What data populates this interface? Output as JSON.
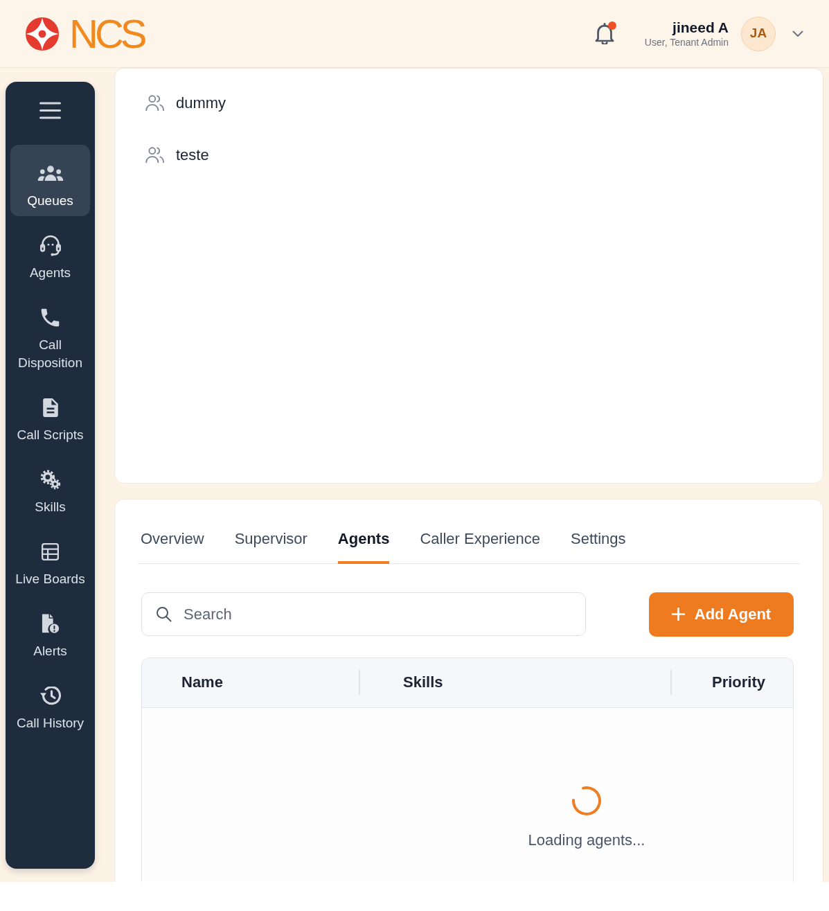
{
  "header": {
    "logo_text": "NCS",
    "notifications": {
      "unread": true
    },
    "user": {
      "name": "jineed A",
      "role": "User, Tenant Admin",
      "initials": "JA"
    }
  },
  "sidebar": {
    "items": [
      {
        "label": "Queues",
        "selected": true
      },
      {
        "label": "Agents",
        "selected": false
      },
      {
        "label": "Call Disposition",
        "selected": false
      },
      {
        "label": "Call Scripts",
        "selected": false
      },
      {
        "label": "Skills",
        "selected": false
      },
      {
        "label": "Live Boards",
        "selected": false
      },
      {
        "label": "Alerts",
        "selected": false
      },
      {
        "label": "Call History",
        "selected": false
      }
    ]
  },
  "queues": [
    {
      "name": "dummy"
    },
    {
      "name": "teste"
    }
  ],
  "details": {
    "tabs": [
      {
        "label": "Overview",
        "selected": false
      },
      {
        "label": "Supervisor",
        "selected": false
      },
      {
        "label": "Agents",
        "selected": true
      },
      {
        "label": "Caller Experience",
        "selected": false
      },
      {
        "label": "Settings",
        "selected": false
      }
    ],
    "search": {
      "placeholder": "Search"
    },
    "add_button": {
      "label": "Add Agent"
    },
    "table": {
      "columns": [
        "Name",
        "Skills",
        "Priority"
      ],
      "loading": true,
      "loading_text": "Loading agents..."
    }
  }
}
